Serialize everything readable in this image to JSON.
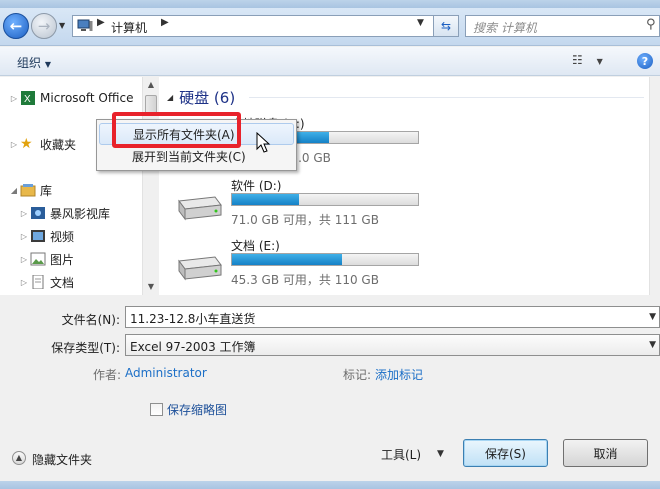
{
  "address": {
    "crumb": "计算机"
  },
  "search": {
    "placeholder": "搜索 计算机"
  },
  "toolbar": {
    "organize": "组织"
  },
  "nav_tree": [
    {
      "label": "Microsoft Office",
      "icon": "excel-icon"
    },
    {
      "label": "收藏夹",
      "icon": "star-icon"
    },
    {
      "label": "库",
      "icon": "library-icon"
    },
    {
      "label": "暴风影视库",
      "icon": "media-library-icon"
    },
    {
      "label": "视频",
      "icon": "video-icon"
    },
    {
      "label": "图片",
      "icon": "picture-icon"
    },
    {
      "label": "文档",
      "icon": "document-icon"
    }
  ],
  "content": {
    "group_title": "硬盘 (6)",
    "drives": [
      {
        "name": "本地磁盘 (C:)",
        "free_text": "可用，共 25.0 GB",
        "used_fraction": 0.52
      },
      {
        "name": "软件 (D:)",
        "free_text": "71.0 GB 可用，共 111 GB",
        "used_fraction": 0.36
      },
      {
        "name": "文档 (E:)",
        "free_text": "45.3 GB 可用，共 110 GB",
        "used_fraction": 0.59
      }
    ]
  },
  "context_menu": {
    "items": [
      "显示所有文件夹(A)",
      "展开到当前文件夹(C)"
    ]
  },
  "form": {
    "filename_label": "文件名(N):",
    "filename_value": "11.23-12.8小车直送货",
    "filetype_label": "保存类型(T):",
    "filetype_value": "Excel 97-2003 工作簿",
    "author_label": "作者:",
    "author_value": "Administrator",
    "tags_label": "标记:",
    "tags_value": "添加标记",
    "thumbnail_label": "保存缩略图"
  },
  "footer": {
    "hide_folders": "隐藏文件夹",
    "tools": "工具(L)",
    "save": "保存(S)",
    "cancel": "取消"
  },
  "colors": {
    "highlight": "#e8222b",
    "drive_bar": "#1581c6",
    "link": "#1c6fc7"
  }
}
